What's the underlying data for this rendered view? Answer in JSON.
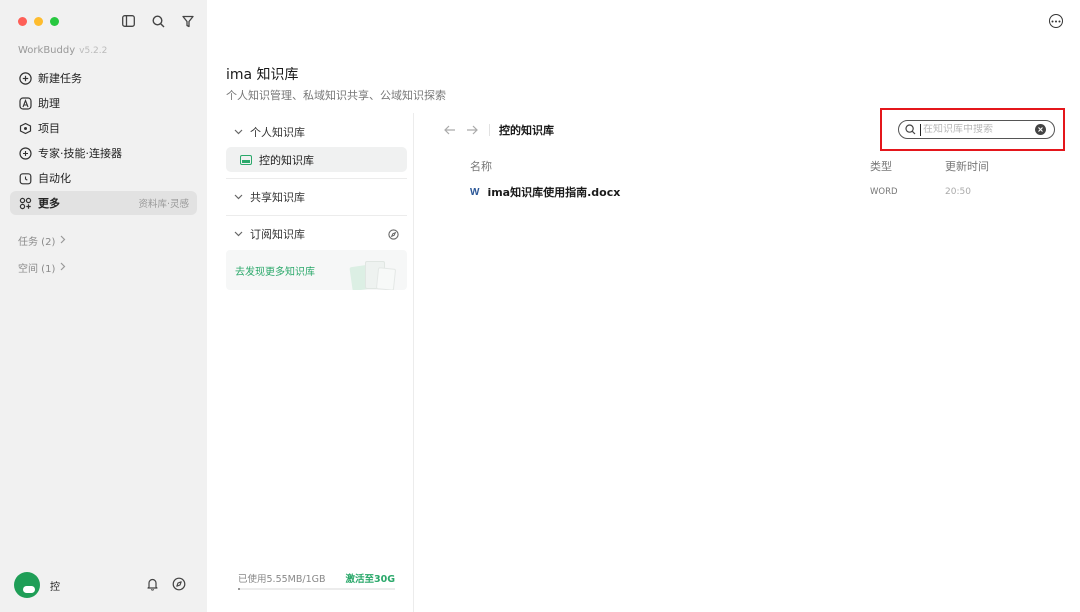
{
  "app": {
    "name": "WorkBuddy",
    "version": "v5.2.2"
  },
  "sidebar": {
    "nav": [
      {
        "label": "新建任务",
        "icon": "plus-circle-icon",
        "sub": ""
      },
      {
        "label": "助理",
        "icon": "assistant-icon",
        "sub": ""
      },
      {
        "label": "项目",
        "icon": "project-icon",
        "sub": ""
      },
      {
        "label": "专家·技能·连接器",
        "icon": "expert-icon",
        "sub": ""
      },
      {
        "label": "自动化",
        "icon": "clock-icon",
        "sub": ""
      },
      {
        "label": "更多",
        "icon": "grid-icon",
        "sub": "资料库·灵感"
      }
    ],
    "tasks_label": "任务 (2)",
    "spaces_label": "空间 (1)",
    "user_name": "控"
  },
  "kb": {
    "title": "ima 知识库",
    "subtitle": "个人知识管理、私域知识共享、公域知识探索",
    "groups": {
      "personal": "个人知识库",
      "personal_leaf": "控的知识库",
      "shared": "共享知识库",
      "subscribed": "订阅知识库",
      "discover": "去发现更多知识库"
    },
    "storage": {
      "used": "已使用5.55MB/1GB",
      "activate": "激活至30G",
      "fraction": 0.0054
    }
  },
  "content": {
    "breadcrumb": "控的知识库",
    "search": {
      "placeholder": "在知识库中搜索",
      "value": ""
    },
    "headers": {
      "name": "名称",
      "type": "类型",
      "updated": "更新时间"
    },
    "files": [
      {
        "name": "ima知识库使用指南.docx",
        "type": "WORD",
        "updated": "20:50",
        "icon": "word-icon"
      }
    ]
  },
  "colors": {
    "accent": "#2aa86a",
    "highlight": "#e4161b",
    "sidebar_bg": "#f1f1f1"
  }
}
